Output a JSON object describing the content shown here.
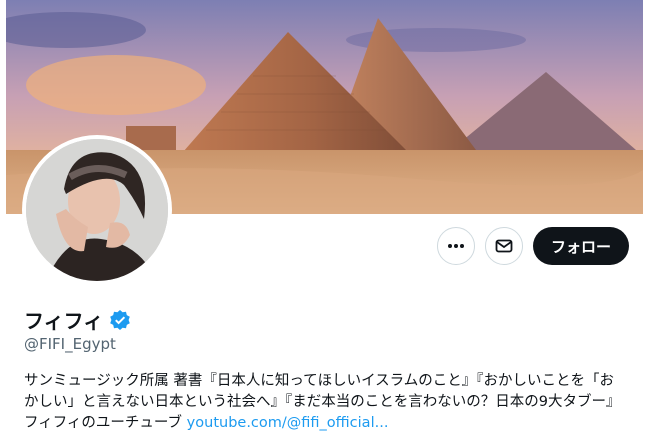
{
  "profile": {
    "display_name": "フィフィ",
    "handle": "@FIFI_Egypt",
    "bio_text": "サンミュージック所属 著書『日本人に知ってほしいイスラムのこと』『おかしいことを「おかしい」と言えない日本という社会へ』『まだ本当のことを言わないの？日本の9大タブー』 フィフィのユーチューブ ",
    "bio_link": "youtube.com/@fifi_official...",
    "verified_icon": "verified-badge-icon"
  },
  "actions": {
    "more_icon": "more-icon",
    "message_icon": "envelope-icon",
    "follow_label": "フォロー"
  },
  "colors": {
    "accent": "#1d9bf0",
    "follow_bg": "#0f1419",
    "secondary_text": "#536471"
  }
}
